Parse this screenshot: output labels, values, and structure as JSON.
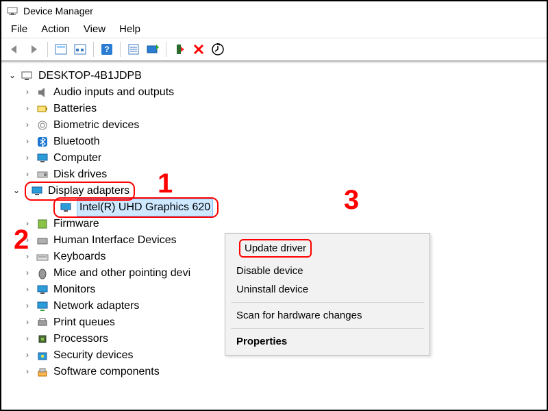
{
  "window": {
    "title": "Device Manager"
  },
  "menu": {
    "file": "File",
    "action": "Action",
    "view": "View",
    "help": "Help"
  },
  "tree": {
    "root": "DESKTOP-4B1JDPB",
    "items": [
      {
        "label": "Audio inputs and outputs"
      },
      {
        "label": "Batteries"
      },
      {
        "label": "Biometric devices"
      },
      {
        "label": "Bluetooth"
      },
      {
        "label": "Computer"
      },
      {
        "label": "Disk drives"
      },
      {
        "label": "Display adapters"
      },
      {
        "label": "Firmware"
      },
      {
        "label": "Human Interface Devices"
      },
      {
        "label": "Keyboards"
      },
      {
        "label": "Mice and other pointing devi"
      },
      {
        "label": "Monitors"
      },
      {
        "label": "Network adapters"
      },
      {
        "label": "Print queues"
      },
      {
        "label": "Processors"
      },
      {
        "label": "Security devices"
      },
      {
        "label": "Software components"
      }
    ],
    "selected_device": "Intel(R) UHD Graphics 620"
  },
  "context_menu": {
    "update": "Update driver",
    "disable": "Disable device",
    "uninstall": "Uninstall device",
    "scan": "Scan for hardware changes",
    "properties": "Properties"
  },
  "annotations": {
    "one": "1",
    "two": "2",
    "three": "3"
  }
}
